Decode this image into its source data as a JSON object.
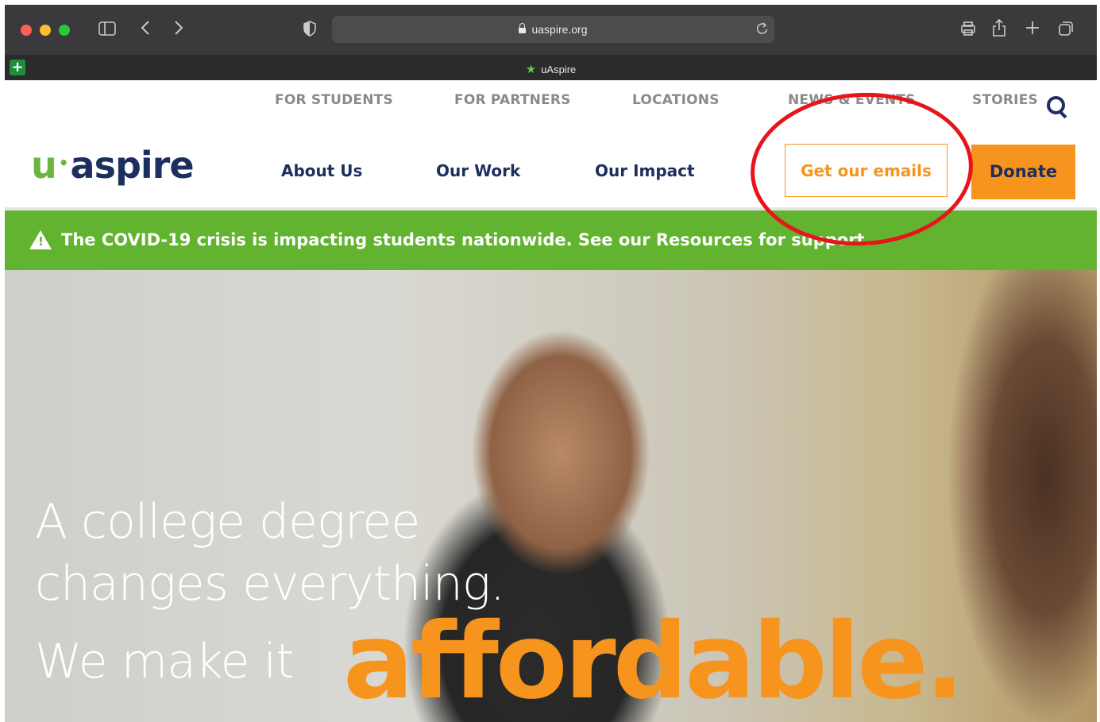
{
  "browser": {
    "url": "uaspire.org",
    "tab_title": "uAspire"
  },
  "site": {
    "util_nav": [
      "FOR STUDENTS",
      "FOR PARTNERS",
      "LOCATIONS",
      "NEWS & EVENTS",
      "STORIES"
    ],
    "logo": {
      "u": "u",
      "dot": "•",
      "rest": "aspire"
    },
    "main_nav": [
      "About Us",
      "Our Work",
      "Our Impact"
    ],
    "emails_button": "Get our emails",
    "donate_button": "Donate",
    "banner": "The COVID-19 crisis is impacting students nationwide. See our Resources for support.",
    "hero": {
      "line1": "A college degree",
      "line2": "changes everything.",
      "line3": "We make it",
      "highlight": "affordable."
    }
  },
  "colors": {
    "brand_navy": "#1c2f5e",
    "brand_orange": "#f7941d",
    "brand_green": "#62b32f",
    "annotation_red": "#e8141c"
  }
}
